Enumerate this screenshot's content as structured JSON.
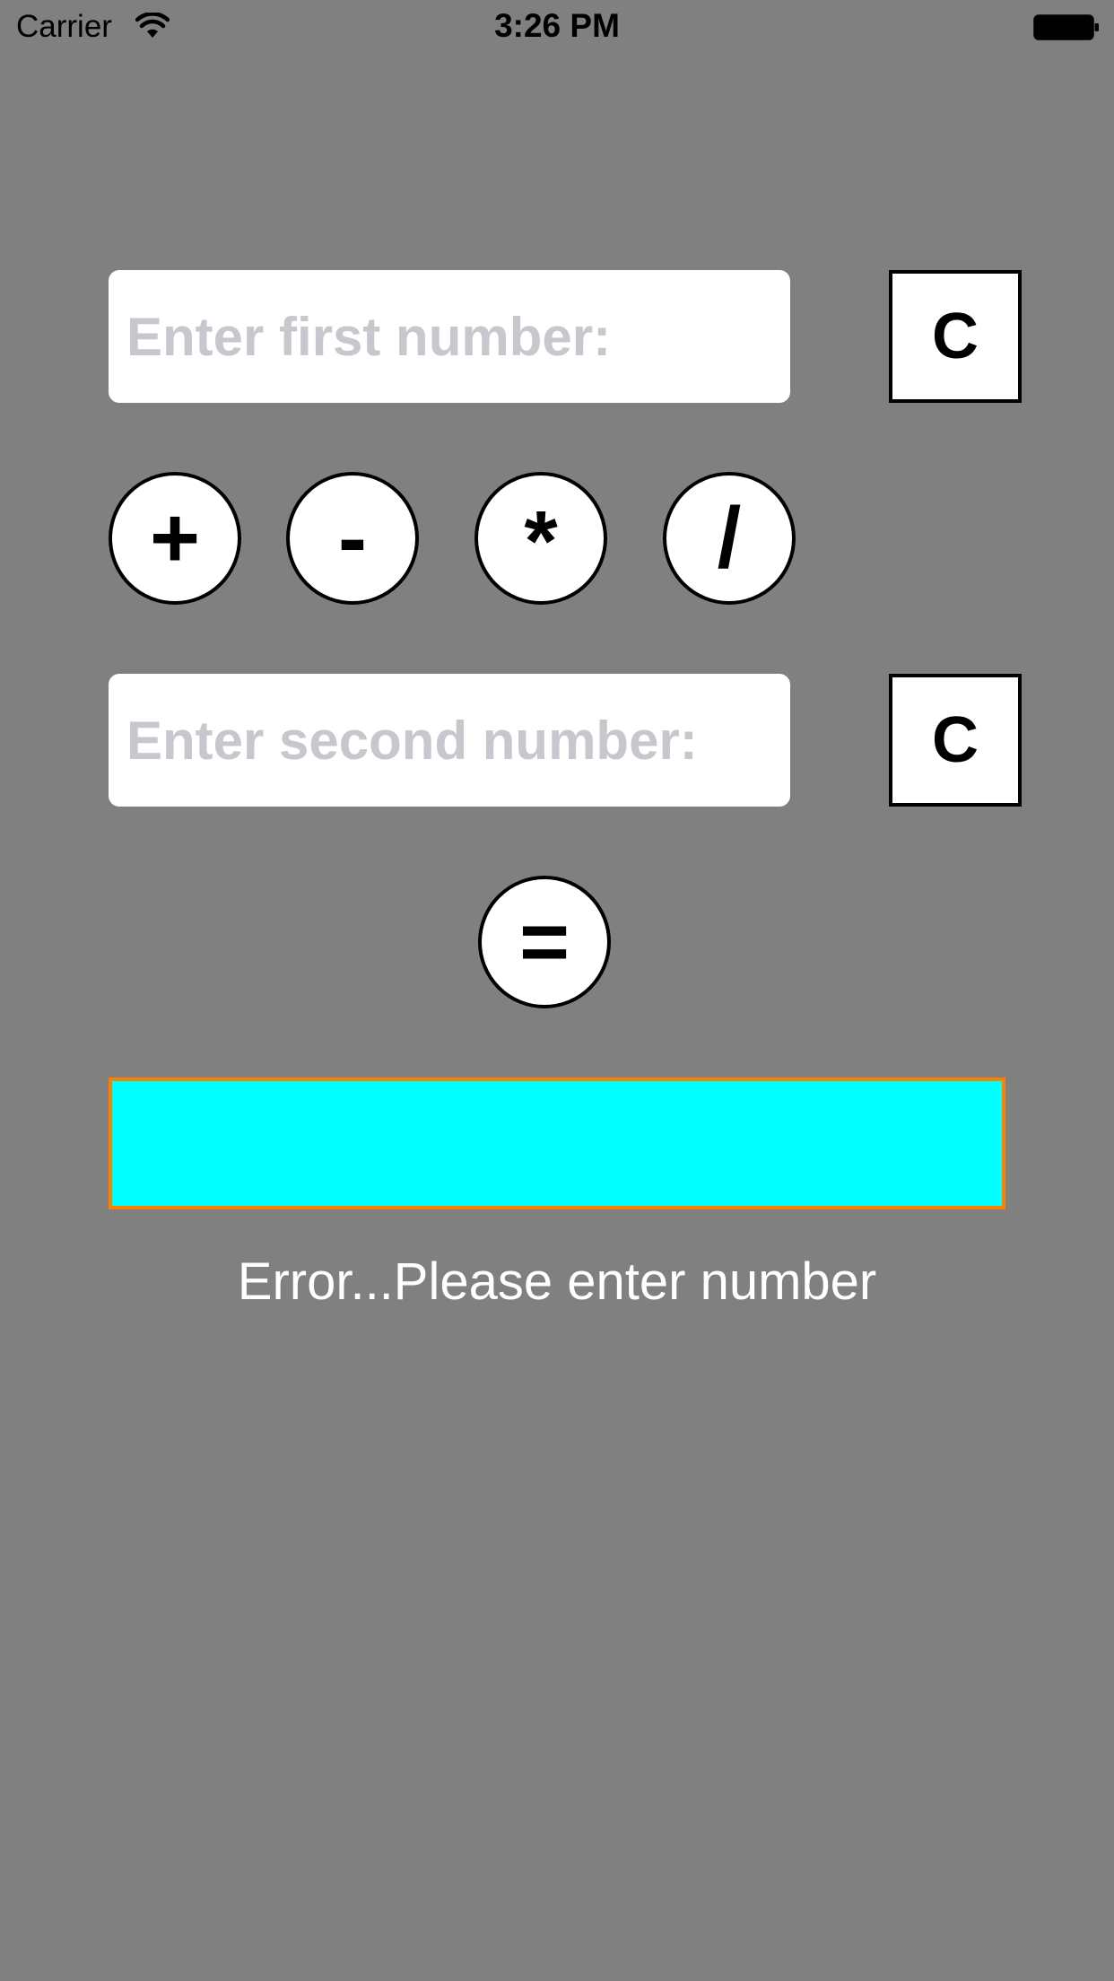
{
  "status_bar": {
    "carrier": "Carrier",
    "time": "3:26 PM",
    "wifi_icon": "wifi-icon",
    "battery_icon": "battery-icon"
  },
  "calculator": {
    "first_number": {
      "value": "",
      "placeholder": "Enter first number:"
    },
    "second_number": {
      "value": "",
      "placeholder": "Enter second number:"
    },
    "clear_first_label": "C",
    "clear_second_label": "C",
    "operators": {
      "add": "+",
      "subtract": "-",
      "multiply": "*",
      "divide": "/"
    },
    "equals_label": "=",
    "result_value": "",
    "error_message": "Error...Please enter number"
  },
  "colors": {
    "background": "#808080",
    "result_fill": "#00ffff",
    "result_border": "#ff8000",
    "placeholder": "#c7c7cd"
  }
}
